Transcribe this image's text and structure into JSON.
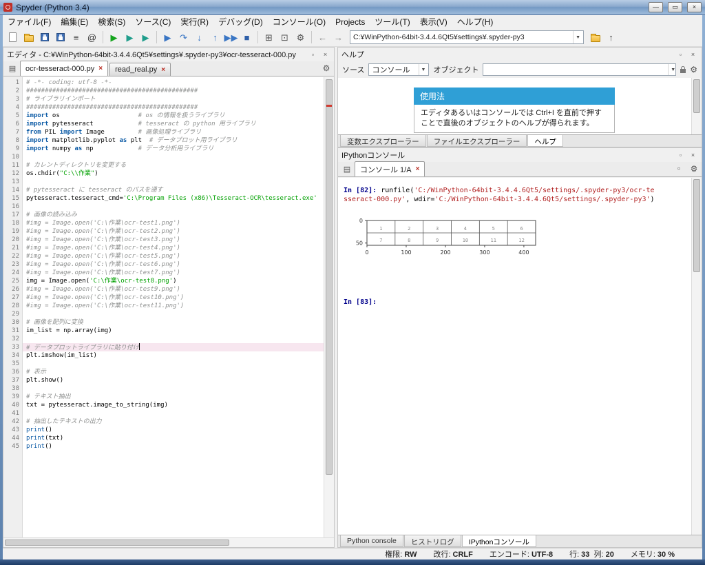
{
  "window": {
    "title": "Spyder (Python 3.4)"
  },
  "menubar": [
    "ファイル(F)",
    "編集(E)",
    "検索(S)",
    "ソース(C)",
    "実行(R)",
    "デバッグ(D)",
    "コンソール(O)",
    "Projects",
    "ツール(T)",
    "表示(V)",
    "ヘルプ(H)"
  ],
  "toolbar": {
    "path_value": "C:¥WinPython-64bit-3.4.4.6Qt5¥settings¥.spyder-py3",
    "icons_left": [
      {
        "n": "new-file",
        "k": "file"
      },
      {
        "n": "open-file",
        "k": "folder"
      },
      {
        "n": "save-file",
        "k": "save"
      },
      {
        "n": "save-all",
        "k": "save"
      },
      {
        "n": "file-switcher",
        "k": "glyph",
        "g": "≡",
        "c": "#555555"
      },
      {
        "n": "symbol-finder",
        "k": "glyph",
        "g": "@",
        "c": "#333333"
      },
      {
        "n": "sep",
        "k": "sep"
      },
      {
        "n": "run",
        "k": "glyph",
        "g": "▶",
        "c": "#14a31c"
      },
      {
        "n": "run-cell",
        "k": "glyph",
        "g": "▶",
        "c": "#1f9d8b"
      },
      {
        "n": "run-cell-advance",
        "k": "glyph",
        "g": "▶",
        "c": "#1f9d8b"
      },
      {
        "n": "sep",
        "k": "sep"
      },
      {
        "n": "debug",
        "k": "glyph",
        "g": "▶",
        "c": "#3a76c4"
      },
      {
        "n": "step",
        "k": "glyph",
        "g": "↷",
        "c": "#3a76c4"
      },
      {
        "n": "step-into",
        "k": "glyph",
        "g": "↓",
        "c": "#3a76c4"
      },
      {
        "n": "step-out",
        "k": "glyph",
        "g": "↑",
        "c": "#3a76c4"
      },
      {
        "n": "continue",
        "k": "glyph",
        "g": "▶▶",
        "c": "#3a76c4"
      },
      {
        "n": "stop",
        "k": "glyph",
        "g": "■",
        "c": "#2e5fa8"
      },
      {
        "n": "sep",
        "k": "sep"
      },
      {
        "n": "maximize-pane",
        "k": "glyph",
        "g": "⊞",
        "c": "#555555"
      },
      {
        "n": "fullscreen",
        "k": "glyph",
        "g": "⊡",
        "c": "#555555"
      },
      {
        "n": "preferences",
        "k": "glyph",
        "g": "⚙",
        "c": "#555555"
      },
      {
        "n": "sep",
        "k": "sep"
      },
      {
        "n": "back",
        "k": "glyph",
        "g": "←",
        "c": "#8a8a8a"
      },
      {
        "n": "forward",
        "k": "glyph",
        "g": "→",
        "c": "#8a8a8a"
      }
    ],
    "icons_right": [
      {
        "n": "open-working-directory",
        "k": "folder"
      },
      {
        "n": "parent-directory",
        "k": "glyph",
        "g": "↑",
        "c": "#444444"
      }
    ]
  },
  "editor": {
    "pane_title": "エディタ - C:¥WinPython-64bit-3.4.4.6Qt5¥settings¥.spyder-py3¥ocr-tesseract-000.py",
    "tabs": [
      {
        "label": "ocr-tesseract-000.py",
        "active": true
      },
      {
        "label": "read_real.py",
        "active": false
      }
    ],
    "current_line": 33,
    "lines": [
      {
        "n": 1,
        "t": [
          [
            "c",
            "# -*- coding: utf-8 -*-"
          ]
        ]
      },
      {
        "n": 2,
        "t": [
          [
            "c",
            "##############################################"
          ]
        ]
      },
      {
        "n": 3,
        "t": [
          [
            "c",
            "# ライブラリインポート"
          ]
        ]
      },
      {
        "n": 4,
        "t": [
          [
            "c",
            "##############################################"
          ]
        ]
      },
      {
        "n": 5,
        "t": [
          [
            "k",
            "import"
          ],
          [
            "t",
            " os                     "
          ],
          [
            "c",
            "# os の情報を扱うライブラリ"
          ]
        ]
      },
      {
        "n": 6,
        "t": [
          [
            "k",
            "import"
          ],
          [
            "t",
            " pytesseract            "
          ],
          [
            "c",
            "# tesseract の python 用ライブラリ"
          ]
        ]
      },
      {
        "n": 7,
        "t": [
          [
            "k",
            "from"
          ],
          [
            "t",
            " PIL "
          ],
          [
            "k",
            "import"
          ],
          [
            "t",
            " Image         "
          ],
          [
            "c",
            "# 画像処理ライブラリ"
          ]
        ]
      },
      {
        "n": 8,
        "t": [
          [
            "k",
            "import"
          ],
          [
            "t",
            " matplotlib.pyplot "
          ],
          [
            "k",
            "as"
          ],
          [
            "t",
            " plt  "
          ],
          [
            "c",
            "# データプロット用ライブラリ"
          ]
        ]
      },
      {
        "n": 9,
        "t": [
          [
            "k",
            "import"
          ],
          [
            "t",
            " numpy "
          ],
          [
            "k",
            "as"
          ],
          [
            "t",
            " np            "
          ],
          [
            "c",
            "# データ分析用ライブラリ"
          ]
        ]
      },
      {
        "n": 10,
        "t": []
      },
      {
        "n": 11,
        "t": [
          [
            "c",
            "# カレントディレクトリを変更する"
          ]
        ]
      },
      {
        "n": 12,
        "t": [
          [
            "t",
            "os.chdir("
          ],
          [
            "s",
            "\"C:\\\\作業\""
          ],
          [
            "t",
            ")"
          ]
        ]
      },
      {
        "n": 13,
        "t": []
      },
      {
        "n": 14,
        "t": [
          [
            "c",
            "# pytesseract に tesseract のパスを通す"
          ]
        ]
      },
      {
        "n": 15,
        "t": [
          [
            "t",
            "pytesseract.tesseract_cmd="
          ],
          [
            "s",
            "'C:\\Program Files (x86)\\Tesseract-OCR\\tesseract.exe'"
          ]
        ]
      },
      {
        "n": 16,
        "t": []
      },
      {
        "n": 17,
        "t": [
          [
            "c",
            "# 画像の読み込み"
          ]
        ]
      },
      {
        "n": 18,
        "t": [
          [
            "c",
            "#img = Image.open('C:\\作業\\ocr-test1.png')"
          ]
        ]
      },
      {
        "n": 19,
        "t": [
          [
            "c",
            "#img = Image.open('C:\\作業\\ocr-test2.png')"
          ]
        ]
      },
      {
        "n": 20,
        "t": [
          [
            "c",
            "#img = Image.open('C:\\作業\\ocr-test3.png')"
          ]
        ]
      },
      {
        "n": 21,
        "t": [
          [
            "c",
            "#img = Image.open('C:\\作業\\ocr-test4.png')"
          ]
        ]
      },
      {
        "n": 22,
        "t": [
          [
            "c",
            "#img = Image.open('C:\\作業\\ocr-test5.png')"
          ]
        ]
      },
      {
        "n": 23,
        "t": [
          [
            "c",
            "#img = Image.open('C:\\作業\\ocr-test6.png')"
          ]
        ]
      },
      {
        "n": 24,
        "t": [
          [
            "c",
            "#img = Image.open('C:\\作業\\ocr-test7.png')"
          ]
        ]
      },
      {
        "n": 25,
        "t": [
          [
            "t",
            "img = Image.open("
          ],
          [
            "s",
            "'C:\\作業\\ocr-test8.png'"
          ],
          [
            "t",
            ")"
          ]
        ]
      },
      {
        "n": 26,
        "t": [
          [
            "c",
            "#img = Image.open('C:\\作業\\ocr-test9.png')"
          ]
        ]
      },
      {
        "n": 27,
        "t": [
          [
            "c",
            "#img = Image.open('C:\\作業\\ocr-test10.png')"
          ]
        ]
      },
      {
        "n": 28,
        "t": [
          [
            "c",
            "#img = Image.open('C:\\作業\\ocr-test11.png')"
          ]
        ]
      },
      {
        "n": 29,
        "t": []
      },
      {
        "n": 30,
        "t": [
          [
            "c",
            "# 画像を配列に変換"
          ]
        ]
      },
      {
        "n": 31,
        "t": [
          [
            "t",
            "im_list = np.array(img)"
          ]
        ]
      },
      {
        "n": 32,
        "t": []
      },
      {
        "n": 33,
        "cur": true,
        "t": [
          [
            "c",
            "# データプロットライブラリに貼り付け"
          ]
        ]
      },
      {
        "n": 34,
        "t": [
          [
            "t",
            "plt.imshow(im_list)"
          ]
        ]
      },
      {
        "n": 35,
        "t": []
      },
      {
        "n": 36,
        "t": [
          [
            "c",
            "# 表示"
          ]
        ]
      },
      {
        "n": 37,
        "t": [
          [
            "t",
            "plt.show()"
          ]
        ]
      },
      {
        "n": 38,
        "t": []
      },
      {
        "n": 39,
        "t": [
          [
            "c",
            "# テキスト抽出"
          ]
        ]
      },
      {
        "n": 40,
        "t": [
          [
            "t",
            "txt = pytesseract.image_to_string(img)"
          ]
        ]
      },
      {
        "n": 41,
        "t": []
      },
      {
        "n": 42,
        "t": [
          [
            "c",
            "# 抽出したテキストの出力"
          ]
        ]
      },
      {
        "n": 43,
        "t": [
          [
            "b",
            "print"
          ],
          [
            "t",
            "()"
          ]
        ]
      },
      {
        "n": 44,
        "t": [
          [
            "b",
            "print"
          ],
          [
            "t",
            "(txt)"
          ]
        ]
      },
      {
        "n": 45,
        "t": [
          [
            "b",
            "print"
          ],
          [
            "t",
            "()"
          ]
        ]
      }
    ]
  },
  "help": {
    "pane_title": "ヘルプ",
    "source_label": "ソース",
    "source_value": "コンソール",
    "object_label": "オブジェクト",
    "object_value": "",
    "usage_title": "使用法",
    "usage_text": "エディタあるいはコンソールでは Ctrl+I を直前で押すことで直後のオブジェクトのヘルプが得られます。",
    "dock_tabs": [
      "変数エクスプローラー",
      "ファイルエクスプローラー",
      "ヘルプ"
    ],
    "dock_active_index": 2
  },
  "console": {
    "pane_title": "IPythonコンソール",
    "tab_label": "コンソール 1/A",
    "in82_prompt": "In [82]: ",
    "in82_segments": [
      [
        "t",
        "runfile("
      ],
      [
        "s",
        "'C:/WinPython-64bit-3.4.4.6Qt5/settings/.spyder-py3/ocr-tesseract-000.py'"
      ],
      [
        "t",
        ", wdir="
      ],
      [
        "s",
        "'C:/WinPython-64bit-3.4.4.6Qt5/settings/.spyder-py3'"
      ],
      [
        "t",
        ")"
      ]
    ],
    "in83_prompt": "In [83]:",
    "bottom_tabs": [
      "Python console",
      "ヒストリログ",
      "IPythonコンソール"
    ],
    "bottom_active_index": 2
  },
  "chart_data": {
    "type": "table",
    "title": "",
    "xlabel": "",
    "ylabel": "",
    "x_ticks": [
      0,
      100,
      200,
      300,
      400
    ],
    "y_ticks": [
      0,
      50
    ],
    "xlim": [
      0,
      430
    ],
    "ylim": [
      55,
      0
    ],
    "table": {
      "rows": [
        [
          "1",
          "2",
          "3",
          "4",
          "5",
          "6"
        ],
        [
          "7",
          "8",
          "9",
          "10",
          "11",
          "12"
        ]
      ]
    }
  },
  "statusbar": {
    "permission_label": "権限:",
    "permission": "RW",
    "eol_label": "改行:",
    "eol": "CRLF",
    "encoding_label": "エンコード:",
    "encoding": "UTF-8",
    "line_label": "行:",
    "line": "33",
    "column_label": "列:",
    "column": "20",
    "memory_label": "メモリ:",
    "memory": "30 %"
  }
}
